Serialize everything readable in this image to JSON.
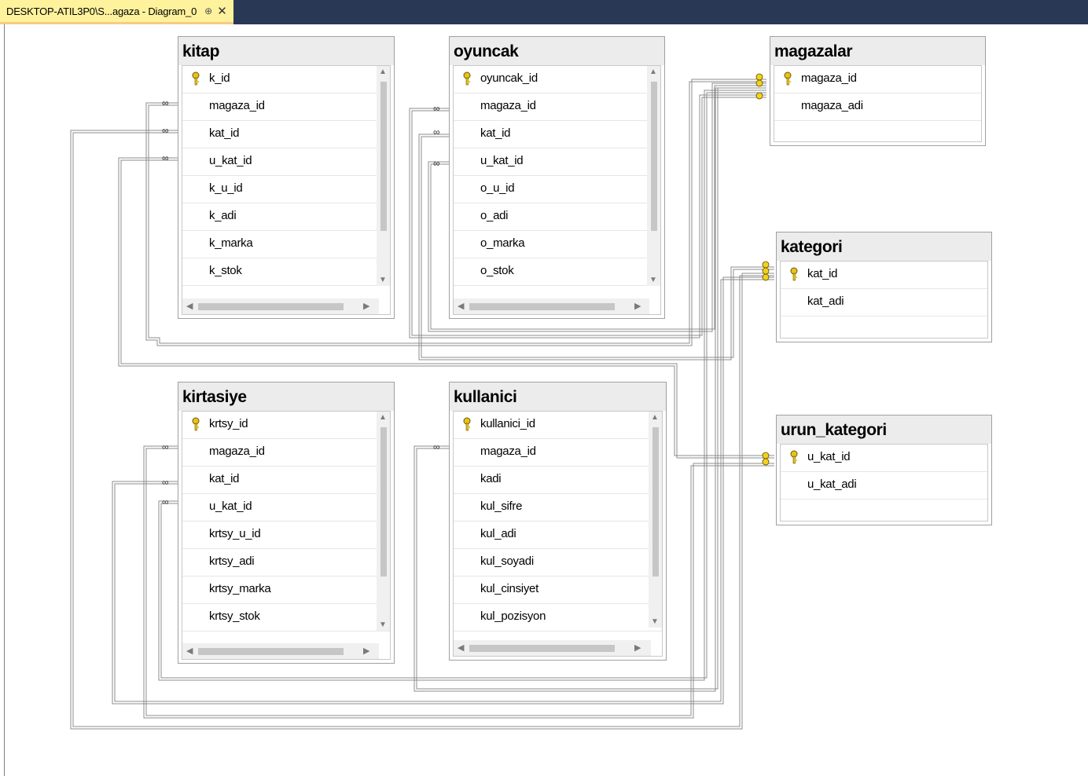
{
  "tab": {
    "title": "DESKTOP-ATIL3P0\\S...agaza - Diagram_0",
    "pin": "⊕",
    "close": "✕"
  },
  "tables": {
    "kitap": {
      "name": "kitap",
      "columns": [
        "k_id",
        "magaza_id",
        "kat_id",
        "u_kat_id",
        "k_u_id",
        "k_adi",
        "k_marka",
        "k_stok"
      ]
    },
    "oyuncak": {
      "name": "oyuncak",
      "columns": [
        "oyuncak_id",
        "magaza_id",
        "kat_id",
        "u_kat_id",
        "o_u_id",
        "o_adi",
        "o_marka",
        "o_stok"
      ]
    },
    "magazalar": {
      "name": "magazalar",
      "columns": [
        "magaza_id",
        "magaza_adi"
      ]
    },
    "kategori": {
      "name": "kategori",
      "columns": [
        "kat_id",
        "kat_adi"
      ]
    },
    "urun_kategori": {
      "name": "urun_kategori",
      "columns": [
        "u_kat_id",
        "u_kat_adi"
      ]
    },
    "kirtasiye": {
      "name": "kirtasiye",
      "columns": [
        "krtsy_id",
        "magaza_id",
        "kat_id",
        "u_kat_id",
        "krtsy_u_id",
        "krtsy_adi",
        "krtsy_marka",
        "krtsy_stok"
      ]
    },
    "kullanici": {
      "name": "kullanici",
      "columns": [
        "kullanici_id",
        "magaza_id",
        "kadi",
        "kul_sifre",
        "kul_adi",
        "kul_soyadi",
        "kul_cinsiyet",
        "kul_pozisyon"
      ]
    }
  },
  "colors": {
    "accent_tab": "#fff29d",
    "topbar": "#293955",
    "key": "#e8c31a"
  }
}
